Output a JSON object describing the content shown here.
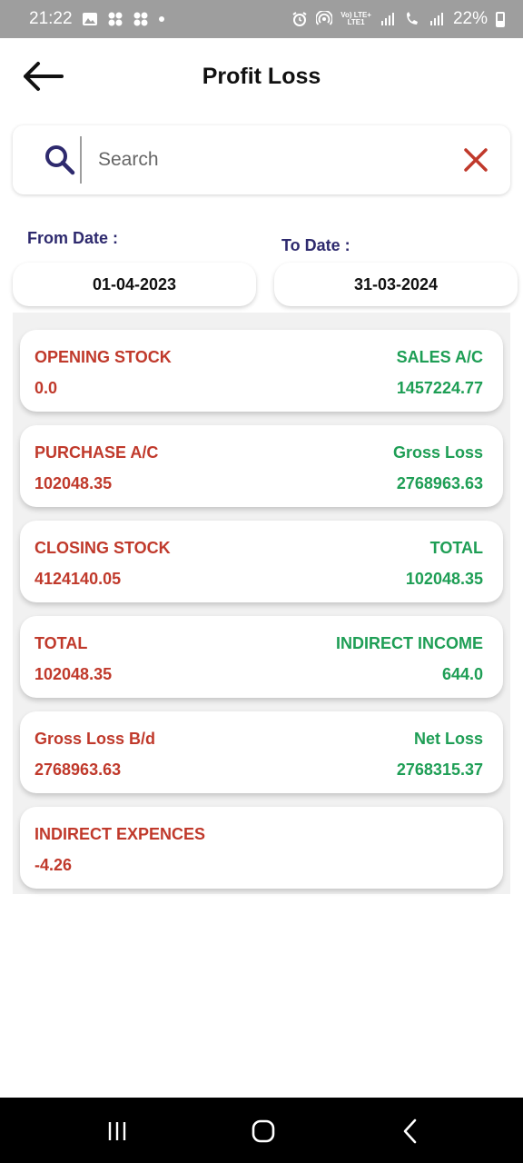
{
  "status_bar": {
    "time": "21:22",
    "battery": "22%",
    "network_top": "Vo) LTE+",
    "network_bottom": "LTE1"
  },
  "header": {
    "title": "Profit Loss"
  },
  "search": {
    "placeholder": "Search"
  },
  "dates": {
    "from_label": "From Date :",
    "from_value": "01-04-2023",
    "to_label": "To Date :",
    "to_value": "31-03-2024"
  },
  "rows": [
    {
      "left_title": "OPENING STOCK",
      "left_value": "0.0",
      "right_title": "SALES A/C",
      "right_value": "1457224.77"
    },
    {
      "left_title": "PURCHASE A/C",
      "left_value": "102048.35",
      "right_title": "Gross Loss",
      "right_value": "2768963.63"
    },
    {
      "left_title": "CLOSING STOCK",
      "left_value": "4124140.05",
      "right_title": "TOTAL",
      "right_value": "102048.35"
    },
    {
      "left_title": "TOTAL",
      "left_value": "102048.35",
      "right_title": "INDIRECT INCOME",
      "right_value": "644.0"
    },
    {
      "left_title": "Gross Loss B/d",
      "left_value": "2768963.63",
      "right_title": "Net Loss",
      "right_value": "2768315.37"
    },
    {
      "left_title": "INDIRECT EXPENCES",
      "left_value": "-4.26",
      "right_title": "",
      "right_value": ""
    }
  ],
  "colors": {
    "debit_text": "#c0392b",
    "credit_text": "#1e9e55",
    "label_text": "#2e2a6e",
    "search_icon": "#2e2a6e",
    "clear_icon": "#c0392b"
  }
}
